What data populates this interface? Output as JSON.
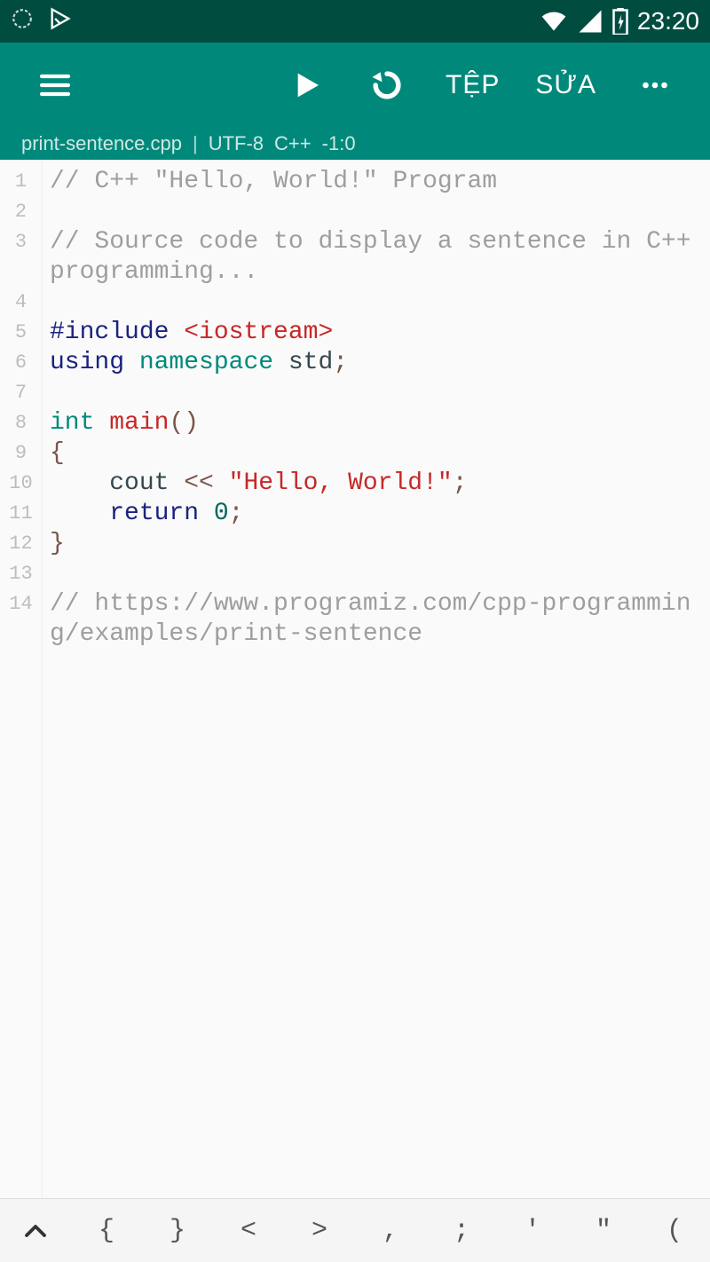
{
  "status": {
    "time": "23:20"
  },
  "appbar": {
    "menu_tep": "TỆP",
    "menu_sua": "SỬA"
  },
  "infobar": {
    "filename": "print-sentence.cpp",
    "sep1": "|",
    "encoding": "UTF-8",
    "lang": "C++",
    "cursor": "-1:0"
  },
  "code": {
    "lines": [
      {
        "n": "1",
        "wrap": 1,
        "tokens": [
          {
            "c": "comment",
            "t": "// C++ \"Hello, World!\" Program"
          }
        ]
      },
      {
        "n": "2",
        "wrap": 1,
        "tokens": [
          {
            "c": "plain",
            "t": ""
          }
        ]
      },
      {
        "n": "3",
        "wrap": 2,
        "tokens": [
          {
            "c": "comment",
            "t": "// Source code to display a sentence in C++ programming..."
          }
        ]
      },
      {
        "n": "4",
        "wrap": 1,
        "tokens": [
          {
            "c": "plain",
            "t": ""
          }
        ]
      },
      {
        "n": "5",
        "wrap": 1,
        "tokens": [
          {
            "c": "pre",
            "t": "#include "
          },
          {
            "c": "include",
            "t": "<iostream>"
          }
        ]
      },
      {
        "n": "6",
        "wrap": 1,
        "tokens": [
          {
            "c": "kw",
            "t": "using "
          },
          {
            "c": "ns",
            "t": "namespace "
          },
          {
            "c": "ident",
            "t": "std"
          },
          {
            "c": "punct",
            "t": ";"
          }
        ]
      },
      {
        "n": "7",
        "wrap": 1,
        "tokens": [
          {
            "c": "plain",
            "t": ""
          }
        ]
      },
      {
        "n": "8",
        "wrap": 1,
        "tokens": [
          {
            "c": "type",
            "t": "int "
          },
          {
            "c": "fn",
            "t": "main"
          },
          {
            "c": "punct",
            "t": "()"
          }
        ]
      },
      {
        "n": "9",
        "wrap": 1,
        "tokens": [
          {
            "c": "punct",
            "t": "{"
          }
        ]
      },
      {
        "n": "10",
        "wrap": 1,
        "tokens": [
          {
            "c": "plain",
            "t": "    "
          },
          {
            "c": "ident",
            "t": "cout "
          },
          {
            "c": "punct",
            "t": "<< "
          },
          {
            "c": "str",
            "t": "\"Hello, World!\""
          },
          {
            "c": "punct",
            "t": ";"
          }
        ]
      },
      {
        "n": "11",
        "wrap": 1,
        "tokens": [
          {
            "c": "plain",
            "t": "    "
          },
          {
            "c": "kw",
            "t": "return "
          },
          {
            "c": "num",
            "t": "0"
          },
          {
            "c": "punct",
            "t": ";"
          }
        ]
      },
      {
        "n": "12",
        "wrap": 1,
        "tokens": [
          {
            "c": "punct",
            "t": "}"
          }
        ]
      },
      {
        "n": "13",
        "wrap": 1,
        "tokens": [
          {
            "c": "plain",
            "t": ""
          }
        ]
      },
      {
        "n": "14",
        "wrap": 3,
        "tokens": [
          {
            "c": "comment",
            "t": "// https://www.programiz.com/cpp-programming/examples/print-sentence"
          }
        ]
      }
    ]
  },
  "symbar": {
    "keys": [
      "{",
      "}",
      "<",
      ">",
      ",",
      ";",
      "'",
      "\"",
      "("
    ]
  }
}
